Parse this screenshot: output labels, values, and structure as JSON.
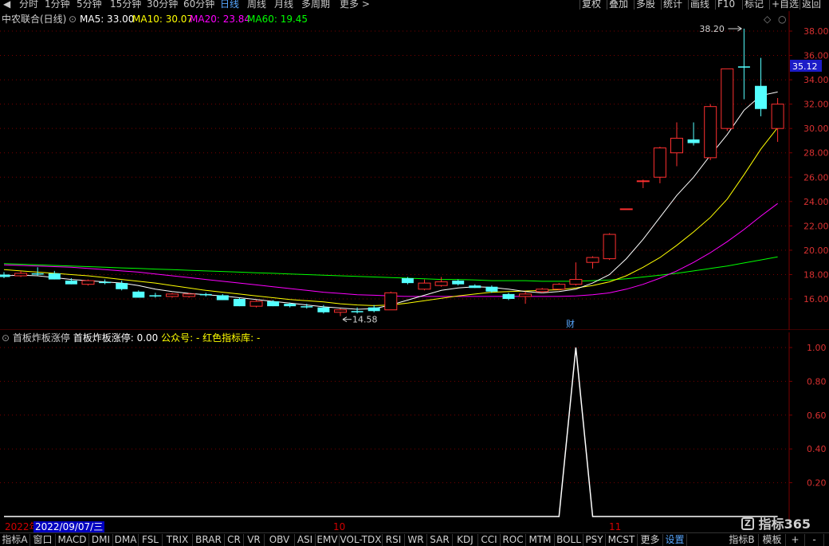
{
  "toolbar": {
    "nav_prev": "◀",
    "periods": [
      "分时",
      "1分钟",
      "5分钟",
      "15分钟",
      "30分钟",
      "60分钟",
      "日线",
      "周线",
      "月线",
      "多周期",
      "更多 >"
    ],
    "active_period": "日线",
    "right_buttons": [
      "复权",
      "叠加",
      "多股",
      "统计",
      "画线",
      "F10",
      "标记",
      "+自选",
      "返回"
    ]
  },
  "stock": {
    "title": "中农联合(日线)",
    "ma": [
      {
        "label": "MA5: 33.00",
        "color": "#ffffff"
      },
      {
        "label": "MA10: 30.07",
        "color": "#ffff00"
      },
      {
        "label": "MA20: 23.84",
        "color": "#ff00ff"
      },
      {
        "label": "MA60: 19.45",
        "color": "#00ff00"
      }
    ],
    "high_label": "38.20",
    "low_label": "14.58",
    "last_price": "35.12",
    "finance_marker": "财"
  },
  "price_axis": [
    "38.00",
    "36.00",
    "34.00",
    "32.00",
    "30.00",
    "28.00",
    "26.00",
    "24.00",
    "22.00",
    "20.00",
    "18.00",
    "16.00"
  ],
  "indicator": {
    "name": "首板炸板涨停",
    "value_label": "首板炸板涨停: 0.00",
    "public_label": "公众号: -",
    "lib_label": "红色指标库: -",
    "axis": [
      "1.00",
      "0.80",
      "0.60",
      "0.40",
      "0.20"
    ]
  },
  "date_bar": {
    "year": "2022年",
    "selected_date": "2022/09/07/三",
    "month_10": "10",
    "month_11": "11"
  },
  "tabs": [
    "指标A",
    "窗口",
    "MACD",
    "DMI",
    "DMA",
    "FSL",
    "TRIX",
    "BRAR",
    "CR",
    "VR",
    "OBV",
    "ASI",
    "EMV",
    "VOL-TDX",
    "RSI",
    "WR",
    "SAR",
    "KDJ",
    "CCI",
    "ROC",
    "MTM",
    "BOLL",
    "PSY",
    "MCST",
    "更多",
    "设置"
  ],
  "active_tab": "设置",
  "right_tabs": [
    "指标B",
    "模板",
    "+",
    "-"
  ],
  "watermark": "指标365",
  "colors": {
    "up": "#ff3030",
    "down": "#54ffff",
    "grid": "#7a0000",
    "axis_text": "#d83030",
    "ma5": "#ffffff",
    "ma10": "#ffff00",
    "ma20": "#ff00ff",
    "ma60": "#00ff00"
  },
  "chart_data": {
    "type": "candlestick",
    "y_range": [
      14,
      39
    ],
    "candles": [
      {
        "o": 18.0,
        "h": 18.2,
        "l": 17.7,
        "c": 17.8
      },
      {
        "o": 17.9,
        "h": 18.3,
        "l": 17.8,
        "c": 18.1
      },
      {
        "o": 18.1,
        "h": 18.6,
        "l": 17.9,
        "c": 18.0
      },
      {
        "o": 18.1,
        "h": 18.3,
        "l": 17.6,
        "c": 17.6
      },
      {
        "o": 17.5,
        "h": 17.7,
        "l": 17.2,
        "c": 17.2
      },
      {
        "o": 17.2,
        "h": 17.6,
        "l": 17.1,
        "c": 17.5
      },
      {
        "o": 17.4,
        "h": 17.6,
        "l": 17.2,
        "c": 17.3
      },
      {
        "o": 17.3,
        "h": 17.5,
        "l": 16.7,
        "c": 16.8
      },
      {
        "o": 16.6,
        "h": 16.7,
        "l": 16.1,
        "c": 16.1
      },
      {
        "o": 16.3,
        "h": 16.5,
        "l": 16.1,
        "c": 16.2
      },
      {
        "o": 16.2,
        "h": 16.5,
        "l": 16.1,
        "c": 16.4
      },
      {
        "o": 16.2,
        "h": 16.5,
        "l": 16.1,
        "c": 16.4
      },
      {
        "o": 16.4,
        "h": 16.5,
        "l": 16.2,
        "c": 16.3
      },
      {
        "o": 16.3,
        "h": 16.4,
        "l": 15.9,
        "c": 15.9
      },
      {
        "o": 16.0,
        "h": 16.1,
        "l": 15.4,
        "c": 15.4
      },
      {
        "o": 15.4,
        "h": 15.9,
        "l": 15.3,
        "c": 15.8
      },
      {
        "o": 15.8,
        "h": 15.9,
        "l": 15.4,
        "c": 15.4
      },
      {
        "o": 15.6,
        "h": 15.7,
        "l": 15.3,
        "c": 15.4
      },
      {
        "o": 15.4,
        "h": 15.6,
        "l": 15.2,
        "c": 15.3
      },
      {
        "o": 15.3,
        "h": 15.5,
        "l": 14.8,
        "c": 14.9
      },
      {
        "o": 14.9,
        "h": 15.2,
        "l": 14.58,
        "c": 15.1
      },
      {
        "o": 15.0,
        "h": 15.3,
        "l": 14.8,
        "c": 14.9
      },
      {
        "o": 15.3,
        "h": 15.5,
        "l": 14.9,
        "c": 15.0
      },
      {
        "o": 15.1,
        "h": 16.6,
        "l": 15.1,
        "c": 16.5
      },
      {
        "o": 17.7,
        "h": 17.8,
        "l": 17.2,
        "c": 17.3
      },
      {
        "o": 16.8,
        "h": 17.6,
        "l": 16.7,
        "c": 17.3
      },
      {
        "o": 17.1,
        "h": 17.8,
        "l": 17.0,
        "c": 17.4
      },
      {
        "o": 17.5,
        "h": 17.6,
        "l": 17.1,
        "c": 17.2
      },
      {
        "o": 17.1,
        "h": 17.2,
        "l": 16.9,
        "c": 16.9
      },
      {
        "o": 17.0,
        "h": 17.1,
        "l": 16.5,
        "c": 16.6
      },
      {
        "o": 16.4,
        "h": 16.5,
        "l": 15.9,
        "c": 16.0
      },
      {
        "o": 16.2,
        "h": 16.6,
        "l": 15.6,
        "c": 16.4
      },
      {
        "o": 16.6,
        "h": 16.9,
        "l": 16.5,
        "c": 16.8
      },
      {
        "o": 16.8,
        "h": 17.3,
        "l": 16.7,
        "c": 17.2
      },
      {
        "o": 17.2,
        "h": 19.0,
        "l": 17.1,
        "c": 17.6
      },
      {
        "o": 19.0,
        "h": 19.5,
        "l": 18.5,
        "c": 19.4
      },
      {
        "o": 19.3,
        "h": 21.4,
        "l": 19.2,
        "c": 21.3
      },
      {
        "o": 23.4,
        "h": 23.4,
        "l": 23.4,
        "c": 23.4
      },
      {
        "o": 25.7,
        "h": 25.8,
        "l": 25.1,
        "c": 25.7
      },
      {
        "o": 26.0,
        "h": 28.5,
        "l": 25.5,
        "c": 28.4
      },
      {
        "o": 28.0,
        "h": 30.5,
        "l": 26.9,
        "c": 29.2
      },
      {
        "o": 29.1,
        "h": 30.5,
        "l": 28.6,
        "c": 28.8
      },
      {
        "o": 27.6,
        "h": 32.0,
        "l": 27.4,
        "c": 31.8
      },
      {
        "o": 30.0,
        "h": 34.9,
        "l": 29.8,
        "c": 34.9
      },
      {
        "o": 35.1,
        "h": 38.2,
        "l": 32.4,
        "c": 35.0
      },
      {
        "o": 33.5,
        "h": 35.8,
        "l": 31.0,
        "c": 31.6
      },
      {
        "o": 30.0,
        "h": 32.5,
        "l": 28.9,
        "c": 32.0
      }
    ],
    "ma5": [
      17.9,
      17.95,
      17.9,
      17.75,
      17.6,
      17.5,
      17.4,
      17.3,
      17.1,
      16.8,
      16.6,
      16.45,
      16.35,
      16.25,
      16.1,
      15.95,
      15.8,
      15.65,
      15.5,
      15.35,
      15.25,
      15.15,
      15.2,
      15.5,
      15.9,
      16.3,
      16.7,
      16.9,
      17.0,
      16.95,
      16.8,
      16.6,
      16.5,
      16.6,
      16.8,
      17.3,
      18.0,
      19.3,
      20.9,
      22.7,
      24.5,
      26.0,
      27.8,
      29.5,
      31.5,
      32.7,
      33.0
    ],
    "ma10": [
      18.4,
      18.3,
      18.2,
      18.1,
      18.0,
      17.9,
      17.75,
      17.6,
      17.45,
      17.3,
      17.1,
      16.9,
      16.7,
      16.55,
      16.4,
      16.25,
      16.1,
      15.95,
      15.85,
      15.75,
      15.6,
      15.5,
      15.45,
      15.5,
      15.65,
      15.85,
      16.05,
      16.25,
      16.4,
      16.55,
      16.6,
      16.65,
      16.7,
      16.75,
      16.9,
      17.1,
      17.4,
      17.9,
      18.6,
      19.4,
      20.4,
      21.5,
      22.7,
      24.2,
      26.2,
      28.3,
      30.07
    ],
    "ma20": [
      18.8,
      18.75,
      18.7,
      18.65,
      18.6,
      18.5,
      18.4,
      18.3,
      18.2,
      18.05,
      17.9,
      17.75,
      17.6,
      17.45,
      17.3,
      17.15,
      17.0,
      16.85,
      16.7,
      16.55,
      16.45,
      16.35,
      16.3,
      16.25,
      16.2,
      16.2,
      16.2,
      16.2,
      16.2,
      16.2,
      16.2,
      16.2,
      16.2,
      16.2,
      16.25,
      16.35,
      16.5,
      16.8,
      17.2,
      17.7,
      18.3,
      19.0,
      19.8,
      20.7,
      21.7,
      22.8,
      23.84
    ],
    "ma60": [
      18.9,
      18.85,
      18.8,
      18.75,
      18.7,
      18.65,
      18.6,
      18.55,
      18.5,
      18.45,
      18.4,
      18.35,
      18.3,
      18.25,
      18.2,
      18.15,
      18.1,
      18.05,
      18.0,
      17.95,
      17.9,
      17.85,
      17.8,
      17.75,
      17.7,
      17.65,
      17.6,
      17.6,
      17.55,
      17.5,
      17.5,
      17.5,
      17.45,
      17.45,
      17.45,
      17.5,
      17.55,
      17.65,
      17.8,
      17.95,
      18.1,
      18.3,
      18.5,
      18.7,
      18.95,
      19.2,
      19.45
    ],
    "indicator_values": [
      0,
      0,
      0,
      0,
      0,
      0,
      0,
      0,
      0,
      0,
      0,
      0,
      0,
      0,
      0,
      0,
      0,
      0,
      0,
      0,
      0,
      0,
      0,
      0,
      0,
      0,
      0,
      0,
      0,
      0,
      0,
      0,
      0,
      0,
      1,
      0,
      0,
      0,
      0,
      0,
      0,
      0,
      0,
      0,
      0,
      0,
      0
    ],
    "indicator_range": [
      0,
      1
    ]
  }
}
